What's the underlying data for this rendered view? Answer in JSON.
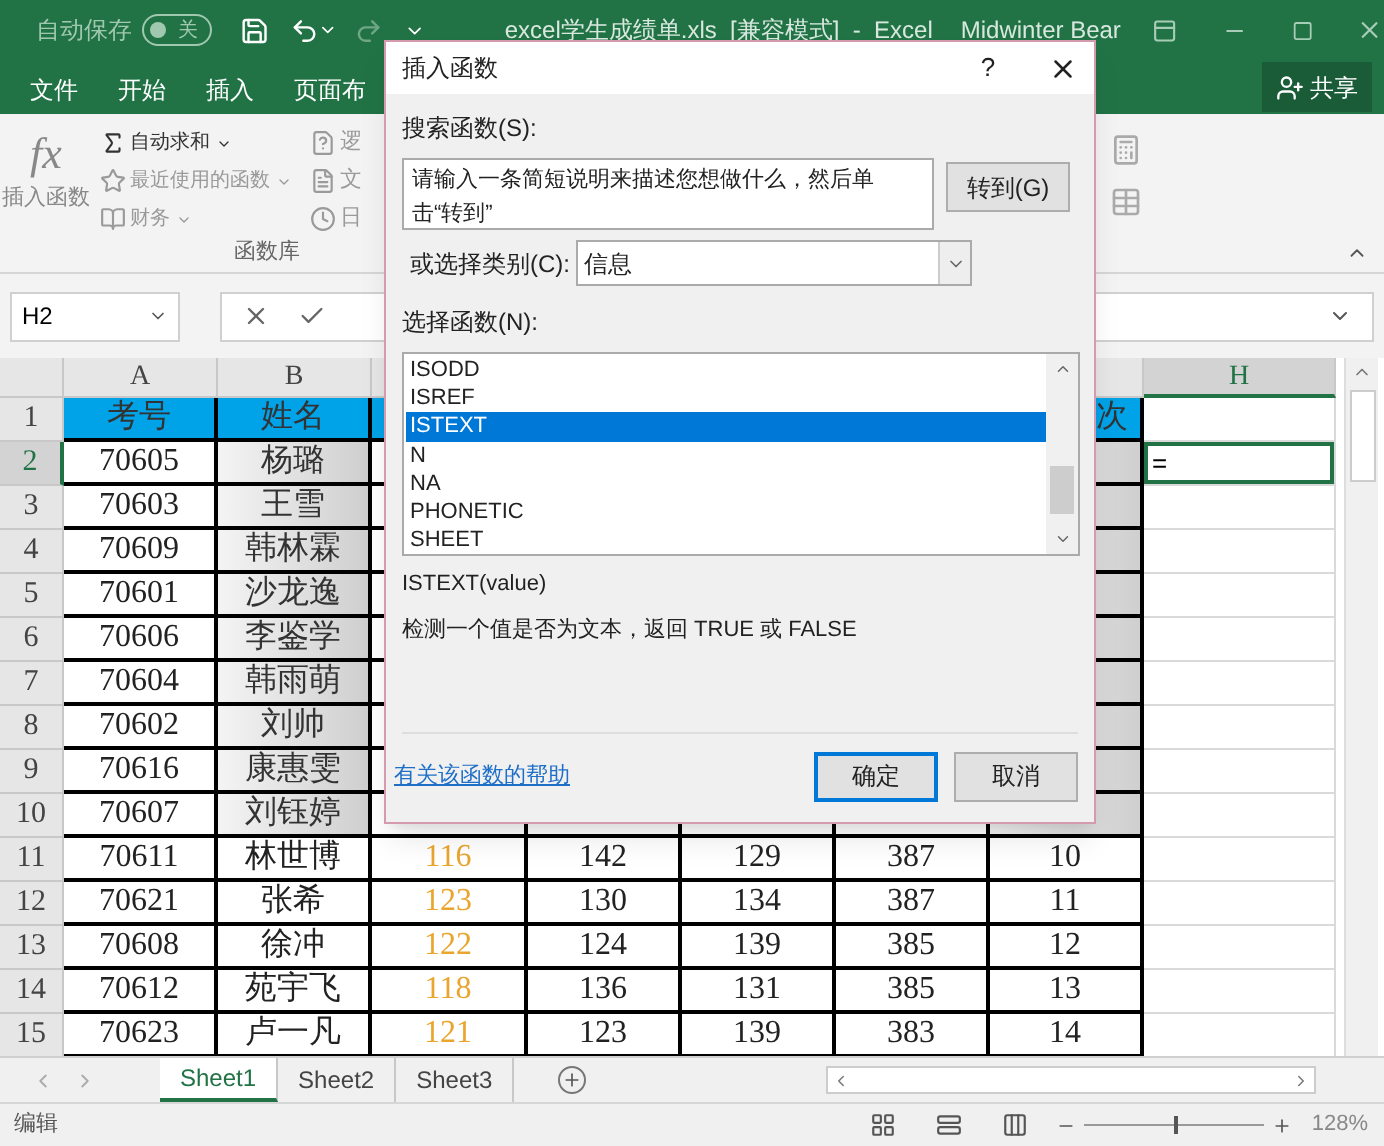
{
  "title_bar": {
    "autosave_label": "自动保存",
    "autosave_state": "关",
    "autosave_on": false,
    "title": "excel学生成绩单.xls  [兼容模式]  -  Excel",
    "user": "Midwinter Bear"
  },
  "ribbon_tabs": [
    {
      "label": "文件",
      "selected": false
    },
    {
      "label": "开始",
      "selected": false
    },
    {
      "label": "插入",
      "selected": false
    },
    {
      "label": "页面布",
      "selected": false
    }
  ],
  "share_button": "共享",
  "ribbon": {
    "insert_function": {
      "icon_text": "fx",
      "label": "插入函数"
    },
    "items": [
      {
        "kind": "sum",
        "label": "自动求和",
        "disabled": false
      },
      {
        "kind": "recent",
        "label": "最近使用的函数",
        "disabled": true
      },
      {
        "kind": "finance",
        "label": "财务",
        "disabled": true
      }
    ],
    "category_items": [
      {
        "kind": "logic",
        "label": "逻"
      },
      {
        "kind": "text",
        "label": "文"
      },
      {
        "kind": "date",
        "label": "日"
      }
    ],
    "group_label": "函数库"
  },
  "formula_bar": {
    "name_box": "H2"
  },
  "columns": [
    {
      "label": "A",
      "selected": false
    },
    {
      "label": "B",
      "selected": false
    },
    {
      "label": "H",
      "selected": true
    }
  ],
  "rows": [
    {
      "header": "1",
      "selected": false,
      "cells": [
        {
          "kind": "heading",
          "text": "考号"
        },
        {
          "kind": "heading",
          "text": "姓名"
        },
        {
          "kind": "heading"
        },
        {
          "kind": "heading"
        },
        {
          "kind": "heading"
        },
        {
          "kind": "heading"
        },
        {
          "kind": "heading",
          "text": "次"
        },
        {
          "kind": "blank"
        }
      ]
    },
    {
      "header": "2",
      "selected": true,
      "cells": [
        {
          "kind": "plain",
          "text": "70605"
        },
        {
          "kind": "shaded",
          "text": "杨璐"
        },
        {
          "kind": "plain"
        },
        {
          "kind": "plain"
        },
        {
          "kind": "plain"
        },
        {
          "kind": "plain"
        },
        {
          "kind": "shaded"
        },
        {
          "kind": "blank",
          "text": "="
        }
      ]
    },
    {
      "header": "3",
      "selected": false,
      "cells": [
        {
          "kind": "plain",
          "text": "70603"
        },
        {
          "kind": "shaded",
          "text": "王雪"
        },
        {
          "kind": "plain"
        },
        {
          "kind": "plain"
        },
        {
          "kind": "plain"
        },
        {
          "kind": "plain"
        },
        {
          "kind": "shaded"
        },
        {
          "kind": "blank"
        }
      ]
    },
    {
      "header": "4",
      "selected": false,
      "cells": [
        {
          "kind": "plain",
          "text": "70609"
        },
        {
          "kind": "shaded",
          "text": "韩林霖"
        },
        {
          "kind": "plain"
        },
        {
          "kind": "plain"
        },
        {
          "kind": "plain"
        },
        {
          "kind": "plain"
        },
        {
          "kind": "shaded"
        },
        {
          "kind": "blank"
        }
      ]
    },
    {
      "header": "5",
      "selected": false,
      "cells": [
        {
          "kind": "plain",
          "text": "70601"
        },
        {
          "kind": "shaded",
          "text": "沙龙逸"
        },
        {
          "kind": "plain"
        },
        {
          "kind": "plain"
        },
        {
          "kind": "plain"
        },
        {
          "kind": "plain"
        },
        {
          "kind": "shaded"
        },
        {
          "kind": "blank"
        }
      ]
    },
    {
      "header": "6",
      "selected": false,
      "cells": [
        {
          "kind": "plain",
          "text": "70606"
        },
        {
          "kind": "shaded",
          "text": "李鉴学"
        },
        {
          "kind": "plain"
        },
        {
          "kind": "plain"
        },
        {
          "kind": "plain"
        },
        {
          "kind": "plain"
        },
        {
          "kind": "shaded"
        },
        {
          "kind": "blank"
        }
      ]
    },
    {
      "header": "7",
      "selected": false,
      "cells": [
        {
          "kind": "plain",
          "text": "70604"
        },
        {
          "kind": "shaded",
          "text": "韩雨萌"
        },
        {
          "kind": "plain"
        },
        {
          "kind": "plain"
        },
        {
          "kind": "plain"
        },
        {
          "kind": "plain"
        },
        {
          "kind": "shaded"
        },
        {
          "kind": "blank"
        }
      ]
    },
    {
      "header": "8",
      "selected": false,
      "cells": [
        {
          "kind": "plain",
          "text": "70602"
        },
        {
          "kind": "shaded",
          "text": "刘帅"
        },
        {
          "kind": "plain"
        },
        {
          "kind": "plain"
        },
        {
          "kind": "plain"
        },
        {
          "kind": "plain"
        },
        {
          "kind": "shaded"
        },
        {
          "kind": "blank"
        }
      ]
    },
    {
      "header": "9",
      "selected": false,
      "cells": [
        {
          "kind": "plain",
          "text": "70616"
        },
        {
          "kind": "shaded",
          "text": "康惠雯"
        },
        {
          "kind": "plain"
        },
        {
          "kind": "plain"
        },
        {
          "kind": "plain"
        },
        {
          "kind": "plain"
        },
        {
          "kind": "shaded"
        },
        {
          "kind": "blank"
        }
      ]
    },
    {
      "header": "10",
      "selected": false,
      "cells": [
        {
          "kind": "plain",
          "text": "70607"
        },
        {
          "kind": "shaded",
          "text": "刘钰婷"
        },
        {
          "kind": "plain"
        },
        {
          "kind": "plain"
        },
        {
          "kind": "plain"
        },
        {
          "kind": "plain"
        },
        {
          "kind": "shaded"
        },
        {
          "kind": "blank"
        }
      ]
    },
    {
      "header": "11",
      "selected": false,
      "cells": [
        {
          "kind": "plain",
          "text": "70611"
        },
        {
          "kind": "plain",
          "text": "林世博"
        },
        {
          "kind": "highlight",
          "text": "116"
        },
        {
          "kind": "plain",
          "text": "142"
        },
        {
          "kind": "plain",
          "text": "129"
        },
        {
          "kind": "plain",
          "text": "387"
        },
        {
          "kind": "plain",
          "text": "10"
        },
        {
          "kind": "blank"
        }
      ]
    },
    {
      "header": "12",
      "selected": false,
      "cells": [
        {
          "kind": "plain",
          "text": "70621"
        },
        {
          "kind": "plain",
          "text": "张希"
        },
        {
          "kind": "highlight",
          "text": "123"
        },
        {
          "kind": "plain",
          "text": "130"
        },
        {
          "kind": "plain",
          "text": "134"
        },
        {
          "kind": "plain",
          "text": "387"
        },
        {
          "kind": "plain",
          "text": "11"
        },
        {
          "kind": "blank"
        }
      ]
    },
    {
      "header": "13",
      "selected": false,
      "cells": [
        {
          "kind": "plain",
          "text": "70608"
        },
        {
          "kind": "plain",
          "text": "徐冲"
        },
        {
          "kind": "highlight",
          "text": "122"
        },
        {
          "kind": "plain",
          "text": "124"
        },
        {
          "kind": "plain",
          "text": "139"
        },
        {
          "kind": "plain",
          "text": "385"
        },
        {
          "kind": "plain",
          "text": "12"
        },
        {
          "kind": "blank"
        }
      ]
    },
    {
      "header": "14",
      "selected": false,
      "cells": [
        {
          "kind": "plain",
          "text": "70612"
        },
        {
          "kind": "plain",
          "text": "苑宇飞"
        },
        {
          "kind": "highlight",
          "text": "118"
        },
        {
          "kind": "plain",
          "text": "136"
        },
        {
          "kind": "plain",
          "text": "131"
        },
        {
          "kind": "plain",
          "text": "385"
        },
        {
          "kind": "plain",
          "text": "13"
        },
        {
          "kind": "blank"
        }
      ]
    },
    {
      "header": "15",
      "selected": false,
      "cells": [
        {
          "kind": "plain",
          "text": "70623"
        },
        {
          "kind": "plain",
          "text": "卢一凡"
        },
        {
          "kind": "highlight",
          "text": "121"
        },
        {
          "kind": "plain",
          "text": "123"
        },
        {
          "kind": "plain",
          "text": "139"
        },
        {
          "kind": "plain",
          "text": "383"
        },
        {
          "kind": "plain",
          "text": "14"
        },
        {
          "kind": "blank"
        }
      ]
    }
  ],
  "sheet_tabs": [
    {
      "label": "Sheet1",
      "selected": true
    },
    {
      "label": "Sheet2",
      "selected": false
    },
    {
      "label": "Sheet3",
      "selected": false
    }
  ],
  "status_bar": {
    "mode": "编辑",
    "zoom": {
      "level": 0.5,
      "reading": "128%"
    }
  },
  "dialog": {
    "title": "插入函数",
    "help_glyph": "?",
    "search_label": "搜索函数(S):",
    "search_placeholder": "请输入一条简短说明来描述您想做什么，然后单击“转到”",
    "go_button": "转到(G)",
    "category_label": "或选择类别(C):",
    "category_value": "信息",
    "function_label": "选择函数(N):",
    "functions": [
      {
        "name": "ISODD",
        "selected": false
      },
      {
        "name": "ISREF",
        "selected": false
      },
      {
        "name": "ISTEXT",
        "selected": true
      },
      {
        "name": "N",
        "selected": false
      },
      {
        "name": "NA",
        "selected": false
      },
      {
        "name": "PHONETIC",
        "selected": false
      },
      {
        "name": "SHEET",
        "selected": false
      }
    ],
    "signature": "ISTEXT(value)",
    "description": "检测一个值是否为文本，返回 TRUE 或 FALSE",
    "help_link": "有关该函数的帮助",
    "ok_button": "确定",
    "cancel_button": "取消"
  }
}
